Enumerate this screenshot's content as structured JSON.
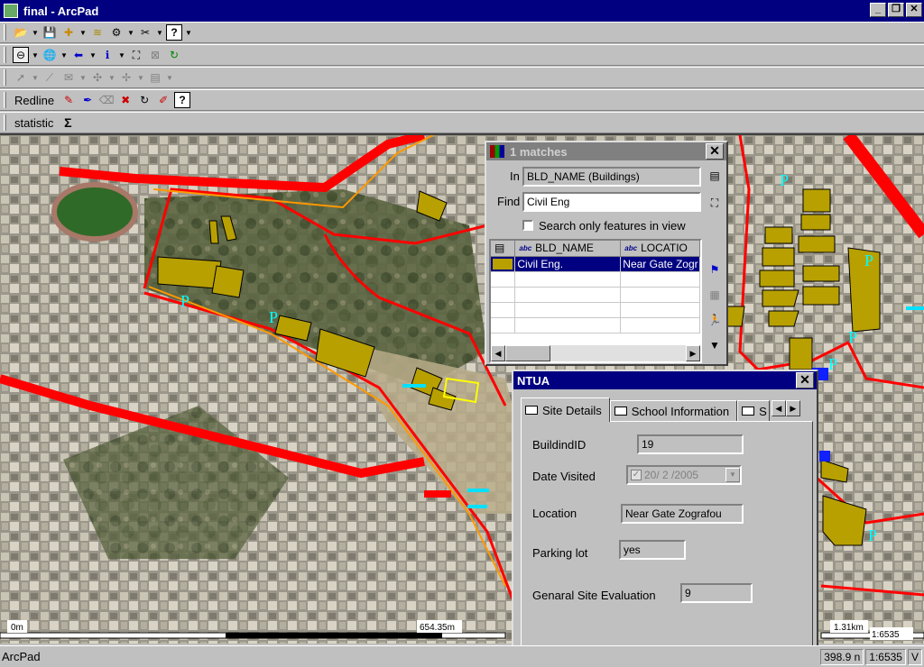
{
  "window": {
    "title": "final - ArcPad"
  },
  "toolbars": {
    "redline_label": "Redline",
    "statistic_label": "statistic"
  },
  "map": {
    "scale_bar": {
      "start": "0m",
      "mid": "654.35m",
      "end": "1.31km"
    },
    "scale_ratio": "1:6535",
    "parking_marker": "P"
  },
  "status": {
    "app_label": "ArcPad",
    "coord": "398.9 n",
    "scale": "1:6535",
    "extra": "V"
  },
  "find_dialog": {
    "title": "1 matches",
    "in_label": "In",
    "in_value": "BLD_NAME (Buildings)",
    "find_label": "Find",
    "find_value": "Civil Eng",
    "search_checkbox_label": "Search only features in view",
    "columns": [
      "BLD_NAME",
      "LOCATIO"
    ],
    "rows": [
      {
        "bld_name": "Civil Eng.",
        "location": "Near Gate Zogr"
      }
    ]
  },
  "ntua_dialog": {
    "title": "NTUA",
    "tabs": [
      "Site Details",
      "School Information",
      "S"
    ],
    "fields": {
      "building_id_label": "BuildindID",
      "building_id": "19",
      "date_label": "Date Visited",
      "date_value": "20/ 2 /2005",
      "location_label": "Location",
      "location_value": "Near Gate Zografou",
      "parking_label": "Parking lot",
      "parking_value": "yes",
      "evaluation_label": "Genaral Site Evaluation",
      "evaluation_value": "9"
    }
  },
  "colors": {
    "road_red": "#ff0000",
    "boundary_orange": "#ff9900",
    "building_fill": "#b8a000",
    "parking_cyan": "#00ffff",
    "title_active": "#000080"
  }
}
